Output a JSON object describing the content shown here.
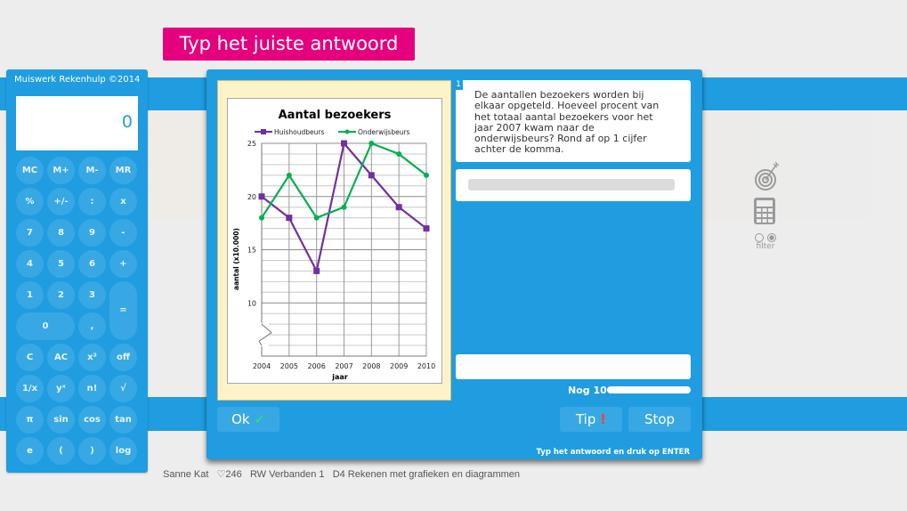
{
  "banner": {
    "title": "Typ het juiste antwoord"
  },
  "calculator": {
    "title": "Muiswerk Rekenhulp ©2014",
    "display": "0",
    "keys": [
      "MC",
      "M+",
      "M-",
      "MR",
      "%",
      "+/-",
      ":",
      "x",
      "7",
      "8",
      "9",
      "-",
      "4",
      "5",
      "6",
      "+",
      "1",
      "2",
      "3",
      "=",
      "0",
      ",",
      "C",
      "AC",
      "x²",
      "off",
      "1/x",
      "yˣ",
      "n!",
      "√",
      "π",
      "sin",
      "cos",
      "tan",
      "e",
      "(",
      ")",
      "log"
    ]
  },
  "question": {
    "number": "1",
    "text": "De aantallen bezoekers worden bij elkaar opgeteld. Hoeveel procent van het totaal aantal bezoekers voor het jaar 2007 kwam naar de onderwijsbeurs? Rond af op 1 cijfer achter de komma."
  },
  "answer": {
    "value": "",
    "placeholder": ""
  },
  "progress": {
    "label": "Nog 10",
    "remaining_fraction": 1.0
  },
  "buttons": {
    "ok": "Ok",
    "ok_mark": "✓",
    "tip": "Tip",
    "tip_mark": "!",
    "stop": "Stop"
  },
  "hint": "Typ het antwoord en druk op ENTER",
  "footer": {
    "user": "Sanne Kat",
    "hearts": "♡246",
    "module": "RW Verbanden 1",
    "topic": "D4 Rekenen met grafieken en diagrammen"
  },
  "side": {
    "filter_label": "filter",
    "icons": [
      "target-icon",
      "calculator-icon"
    ]
  },
  "colors": {
    "accent": "#1f9de0",
    "banner": "#e5007e",
    "series1": "#7030a0",
    "series2": "#00b050"
  },
  "chart_data": {
    "type": "line",
    "title": "Aantal bezoekers",
    "xlabel": "jaar",
    "ylabel": "aantal (x10.000)",
    "x": [
      "2004",
      "2005",
      "2006",
      "2007",
      "2008",
      "2009",
      "2010"
    ],
    "series": [
      {
        "name": "Huishoudbeurs",
        "values": [
          20,
          18,
          13,
          25,
          22,
          19,
          17
        ],
        "color": "#7030a0",
        "marker": "square"
      },
      {
        "name": "Onderwijsbeurs",
        "values": [
          18,
          22,
          18,
          19,
          25,
          24,
          22
        ],
        "color": "#00b050",
        "marker": "circle"
      }
    ],
    "yticks": [
      "10",
      "15",
      "20",
      "25"
    ],
    "ylim": [
      5,
      25
    ],
    "axis_break": true,
    "grid": true,
    "legend": "top"
  }
}
